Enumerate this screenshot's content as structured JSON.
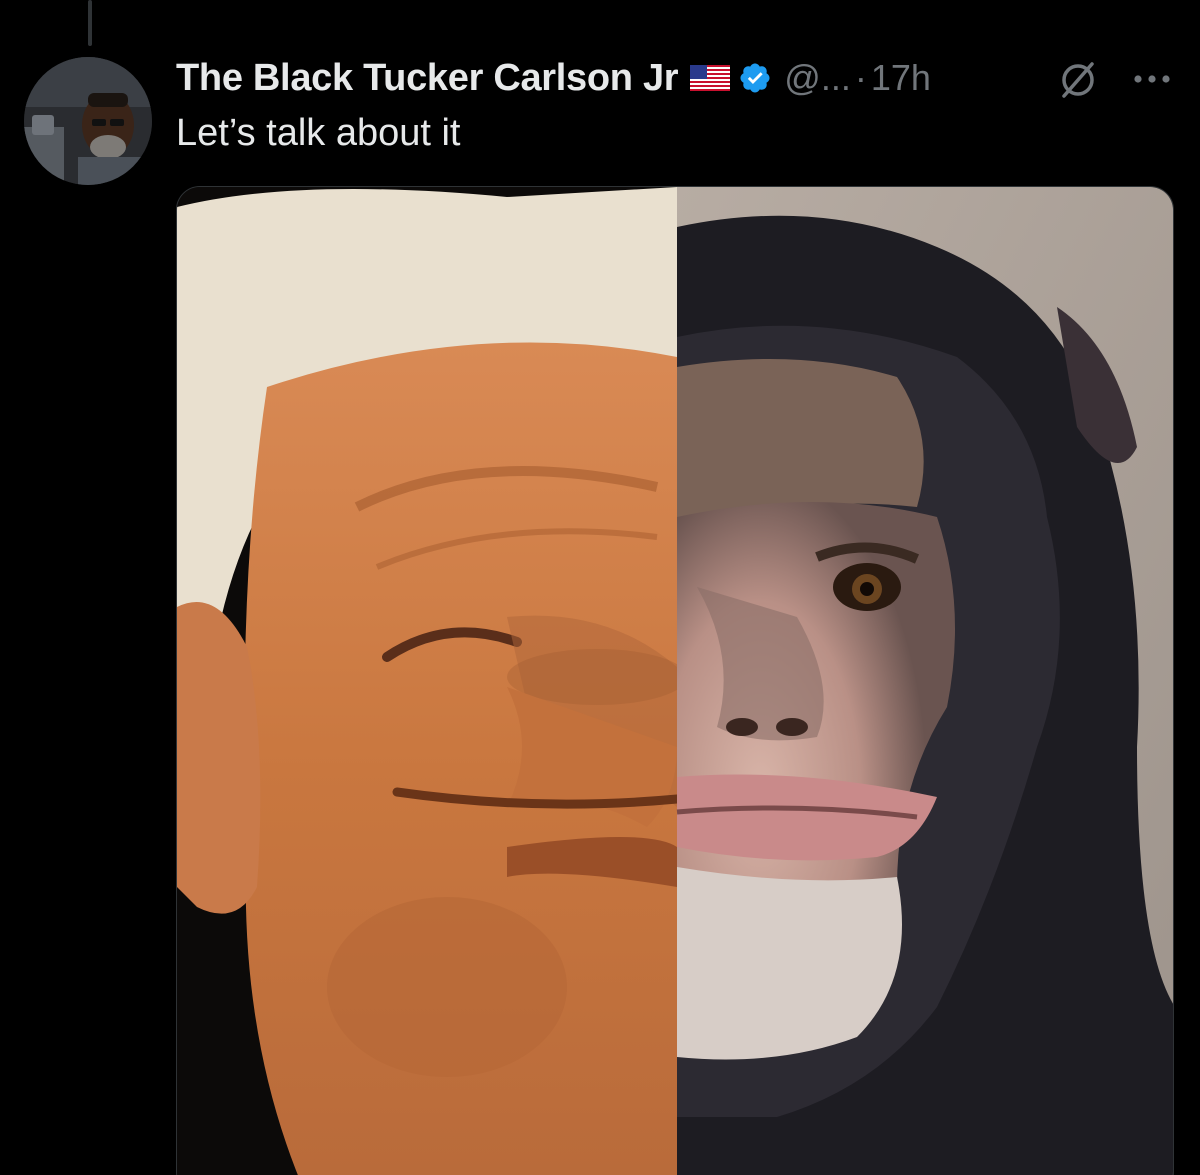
{
  "tweet": {
    "display_name": "The Black Tucker Carlson Jr",
    "handle": "@...",
    "separator": "·",
    "time": "17h",
    "text": "Let’s talk about it",
    "flag_icon": "us-flag-icon",
    "verified_icon": "verified-badge-icon",
    "grok_icon": "grok-icon",
    "more_icon": "more-icon"
  },
  "colors": {
    "background": "#000000",
    "text_primary": "#e7e9ea",
    "text_secondary": "#71767b",
    "verified_blue": "#1d9bf0",
    "thread_line": "#2f3336"
  }
}
